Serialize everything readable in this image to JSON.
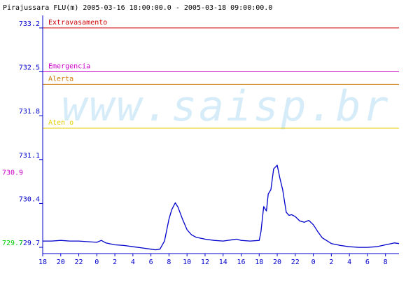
{
  "chart_data": {
    "type": "line",
    "title": "Pirajussara FLU(m) 2005-03-16 18:00:00.0 - 2005-03-18 09:00:00.0",
    "xlabel": "",
    "ylabel": "",
    "ylim": [
      729.6,
      733.4
    ],
    "xlim": [
      18,
      57.5
    ],
    "y_ticks": [
      "733.2",
      "732.5",
      "731.8",
      "731.1",
      "730.4",
      "729.7"
    ],
    "x_ticks": [
      {
        "x": 18,
        "label": "18"
      },
      {
        "x": 20,
        "label": "20"
      },
      {
        "x": 22,
        "label": "22"
      },
      {
        "x": 24,
        "label": "0"
      },
      {
        "x": 26,
        "label": "2"
      },
      {
        "x": 28,
        "label": "4"
      },
      {
        "x": 30,
        "label": "6"
      },
      {
        "x": 32,
        "label": "8"
      },
      {
        "x": 34,
        "label": "10"
      },
      {
        "x": 36,
        "label": "12"
      },
      {
        "x": 38,
        "label": "14"
      },
      {
        "x": 40,
        "label": "16"
      },
      {
        "x": 42,
        "label": "18"
      },
      {
        "x": 44,
        "label": "20"
      },
      {
        "x": 46,
        "label": "22"
      },
      {
        "x": 48,
        "label": "0"
      },
      {
        "x": 50,
        "label": "2"
      },
      {
        "x": 52,
        "label": "4"
      },
      {
        "x": 54,
        "label": "6"
      },
      {
        "x": 56,
        "label": "8"
      }
    ],
    "thresholds": [
      {
        "name": "Extravasamento",
        "value": 733.2,
        "color": "#cc0000"
      },
      {
        "name": "Emergencia",
        "value": 732.5,
        "color": "#cc00cc"
      },
      {
        "name": "Alerta",
        "value": 732.3,
        "color": "#cc7700"
      },
      {
        "name": "Aten  o",
        "value": 731.6,
        "color": "#e6cc00"
      }
    ],
    "markers": [
      {
        "label": "730.9",
        "value": 730.9,
        "color": "#cc00cc"
      },
      {
        "label": "729.7",
        "value": 729.78,
        "color": "#00cc00"
      }
    ],
    "watermark": "www.saisp.br",
    "series": [
      {
        "color": "#0000cc",
        "x": [
          18,
          19,
          20,
          21,
          22,
          23,
          24,
          24.5,
          25,
          26,
          27,
          28,
          29,
          30,
          30.5,
          31,
          31.5,
          32,
          32.3,
          32.7,
          33,
          33.5,
          34,
          34.5,
          35,
          36,
          37,
          38,
          39,
          39.5,
          40,
          41,
          42,
          42.2,
          42.5,
          42.8,
          43,
          43.3,
          43.6,
          44,
          44.3,
          44.6,
          45,
          45.3,
          45.6,
          46,
          46.5,
          47,
          47.5,
          48,
          48.5,
          49,
          50,
          51,
          52,
          53,
          54,
          55,
          56,
          57,
          57.5
        ],
        "y": [
          729.8,
          729.8,
          729.81,
          729.8,
          729.8,
          729.79,
          729.78,
          729.81,
          729.77,
          729.74,
          729.73,
          729.71,
          729.69,
          729.67,
          729.66,
          729.67,
          729.8,
          730.15,
          730.3,
          730.41,
          730.34,
          730.15,
          729.98,
          729.9,
          729.86,
          729.83,
          729.81,
          729.8,
          729.82,
          729.83,
          729.81,
          729.8,
          729.81,
          729.95,
          730.35,
          730.28,
          730.55,
          730.62,
          730.95,
          731.01,
          730.8,
          730.62,
          730.26,
          730.21,
          730.22,
          730.19,
          730.12,
          730.1,
          730.13,
          730.06,
          729.95,
          729.85,
          729.76,
          729.73,
          729.71,
          729.7,
          729.7,
          729.71,
          729.74,
          729.77,
          729.76
        ]
      }
    ]
  }
}
